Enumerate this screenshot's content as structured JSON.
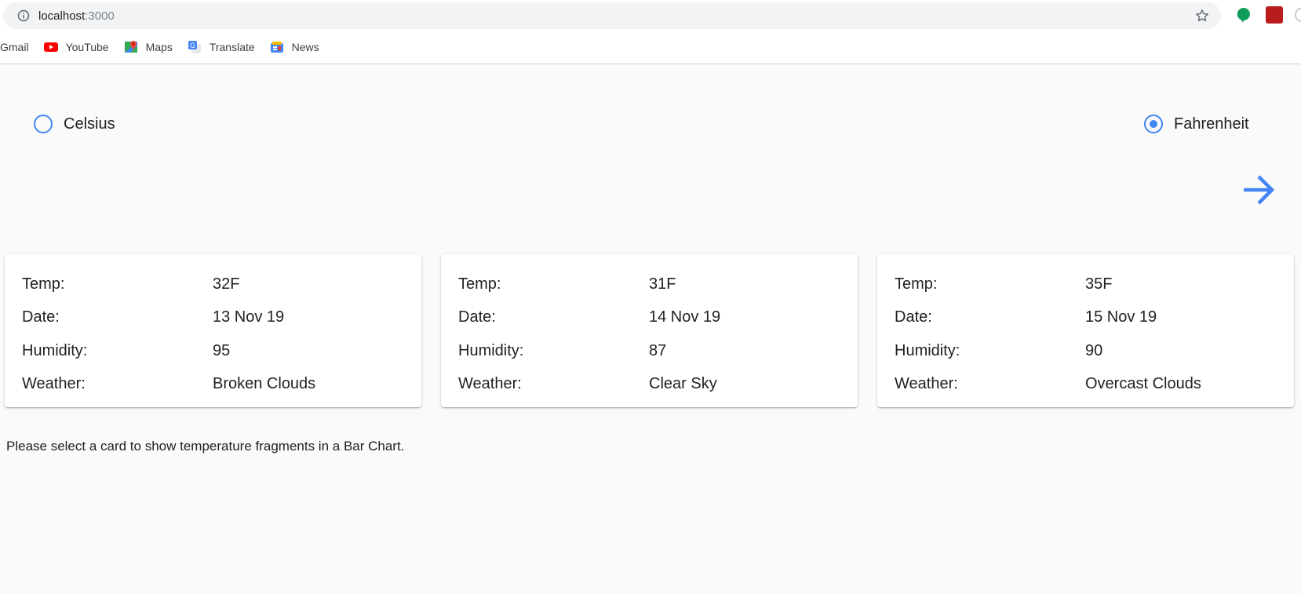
{
  "browser": {
    "url_host": "localhost",
    "url_port": ":3000",
    "bookmarks": [
      {
        "label": "Gmail",
        "icon": "gmail-icon"
      },
      {
        "label": "YouTube",
        "icon": "youtube-icon"
      },
      {
        "label": "Maps",
        "icon": "maps-icon"
      },
      {
        "label": "Translate",
        "icon": "translate-icon"
      },
      {
        "label": "News",
        "icon": "news-icon"
      }
    ]
  },
  "units": {
    "celsius_label": "Celsius",
    "fahrenheit_label": "Fahrenheit",
    "selected": "fahrenheit"
  },
  "cards": [
    {
      "temp_label": "Temp:",
      "temp": "32F",
      "date_label": "Date:",
      "date": "13 Nov 19",
      "humidity_label": "Humidity:",
      "humidity": "95",
      "weather_label": "Weather:",
      "weather": "Broken Clouds"
    },
    {
      "temp_label": "Temp:",
      "temp": "31F",
      "date_label": "Date:",
      "date": "14 Nov 19",
      "humidity_label": "Humidity:",
      "humidity": "87",
      "weather_label": "Weather:",
      "weather": "Clear Sky"
    },
    {
      "temp_label": "Temp:",
      "temp": "35F",
      "date_label": "Date:",
      "date": "15 Nov 19",
      "humidity_label": "Humidity:",
      "humidity": "90",
      "weather_label": "Weather:",
      "weather": "Overcast Clouds"
    }
  ],
  "hint": "Please select a card to show temperature fragments in a Bar Chart.",
  "colors": {
    "accent": "#4285f4",
    "background": "#fafafa",
    "card": "#ffffff"
  }
}
